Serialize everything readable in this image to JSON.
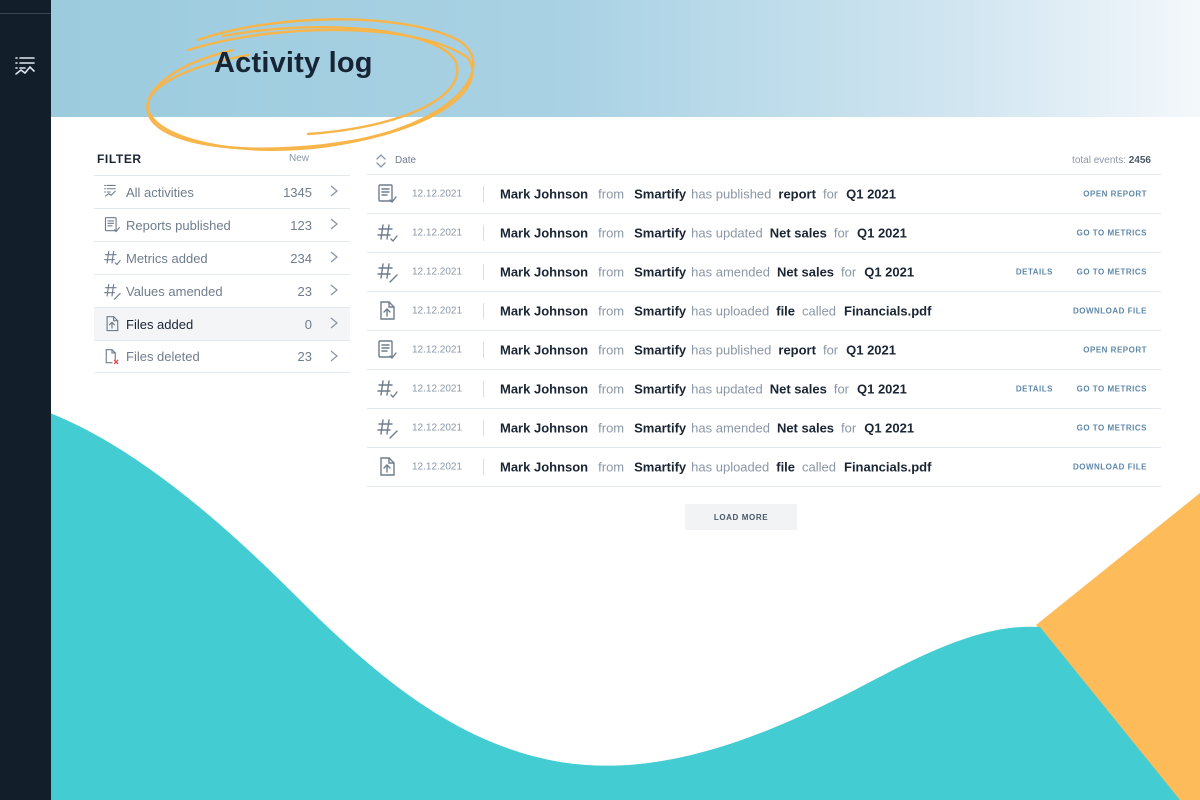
{
  "page": {
    "title": "Activity log"
  },
  "colors": {
    "rail": "#131e2b",
    "teal": "#43cdd2",
    "orange": "#fdbb5a",
    "accent_link": "#5f88a8"
  },
  "filter": {
    "title": "FILTER",
    "new_label": "New",
    "items": [
      {
        "icon": "activity-list-icon",
        "label": "All activities",
        "count": "1345",
        "active": false
      },
      {
        "icon": "report-icon",
        "label": "Reports published",
        "count": "123",
        "active": false
      },
      {
        "icon": "metric-added-icon",
        "label": "Metrics added",
        "count": "234",
        "active": false
      },
      {
        "icon": "value-amended-icon",
        "label": "Values amended",
        "count": "23",
        "active": false
      },
      {
        "icon": "file-upload-icon",
        "label": "Files added",
        "count": "0",
        "active": true
      },
      {
        "icon": "file-deleted-icon",
        "label": "Files deleted",
        "count": "23",
        "active": false
      }
    ]
  },
  "list": {
    "sort_label": "Date",
    "total_label": "total events:",
    "total_value": "2456",
    "rows": [
      {
        "icon": "report-icon",
        "date": "12.12.2021",
        "user": "Mark Johnson",
        "from": "from",
        "org": "Smartify",
        "verb": "has published",
        "object": "report",
        "connector": "for",
        "target": "Q1 2021",
        "action": "OPEN REPORT",
        "detail": ""
      },
      {
        "icon": "metric-added-icon",
        "date": "12.12.2021",
        "user": "Mark Johnson",
        "from": "from",
        "org": "Smartify",
        "verb": "has updated",
        "object": "Net sales",
        "connector": "for",
        "target": "Q1 2021",
        "action": "GO TO METRICS",
        "detail": ""
      },
      {
        "icon": "value-amended-icon",
        "date": "12.12.2021",
        "user": "Mark Johnson",
        "from": "from",
        "org": "Smartify",
        "verb": "has amended",
        "object": "Net sales",
        "connector": "for",
        "target": "Q1 2021",
        "action": "GO TO METRICS",
        "detail": "DETAILS"
      },
      {
        "icon": "file-upload-icon",
        "date": "12.12.2021",
        "user": "Mark Johnson",
        "from": "from",
        "org": "Smartify",
        "verb": "has uploaded",
        "object": "file",
        "connector": "called",
        "target": "Financials.pdf",
        "action": "DOWNLOAD FILE",
        "detail": ""
      },
      {
        "icon": "report-icon",
        "date": "12.12.2021",
        "user": "Mark Johnson",
        "from": "from",
        "org": "Smartify",
        "verb": "has published",
        "object": "report",
        "connector": "for",
        "target": "Q1 2021",
        "action": "OPEN REPORT",
        "detail": ""
      },
      {
        "icon": "metric-added-icon",
        "date": "12.12.2021",
        "user": "Mark Johnson",
        "from": "from",
        "org": "Smartify",
        "verb": "has updated",
        "object": "Net sales",
        "connector": "for",
        "target": "Q1 2021",
        "action": "GO TO METRICS",
        "detail": "DETAILS"
      },
      {
        "icon": "value-amended-icon",
        "date": "12.12.2021",
        "user": "Mark Johnson",
        "from": "from",
        "org": "Smartify",
        "verb": "has amended",
        "object": "Net sales",
        "connector": "for",
        "target": "Q1 2021",
        "action": "GO TO METRICS",
        "detail": ""
      },
      {
        "icon": "file-upload-icon",
        "date": "12.12.2021",
        "user": "Mark Johnson",
        "from": "from",
        "org": "Smartify",
        "verb": "has uploaded",
        "object": "file",
        "connector": "called",
        "target": "Financials.pdf",
        "action": "DOWNLOAD FILE",
        "detail": ""
      }
    ],
    "load_more": "LOAD MORE"
  }
}
